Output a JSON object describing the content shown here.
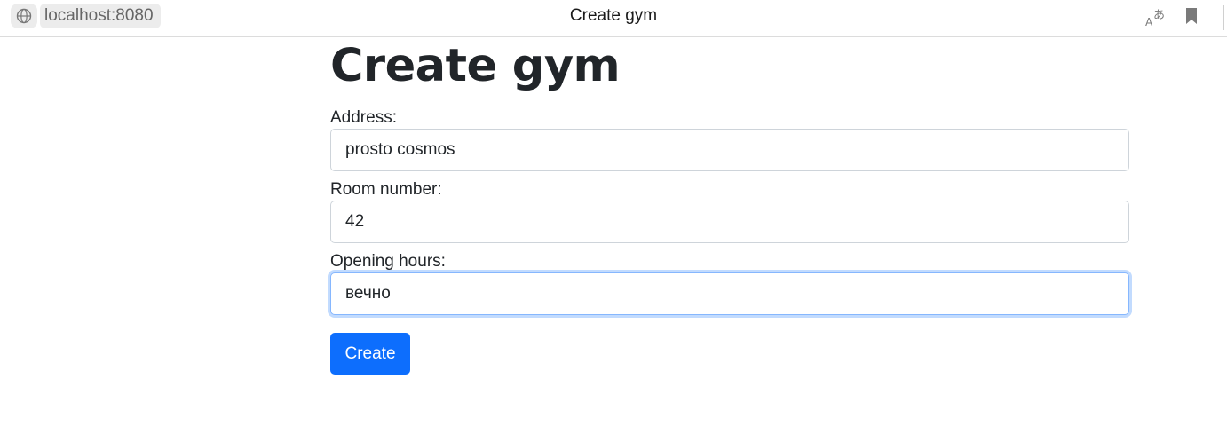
{
  "browser": {
    "url": "localhost:8080",
    "tab_title": "Create gym"
  },
  "page": {
    "heading": "Create gym",
    "fields": [
      {
        "label": "Address:",
        "value": "prosto cosmos"
      },
      {
        "label": "Room number:",
        "value": "42"
      },
      {
        "label": "Opening hours:",
        "value": "вечно"
      }
    ],
    "submit_label": "Create"
  },
  "colors": {
    "primary": "#0d6efd",
    "focus_border": "#86b7fe",
    "text": "#212529"
  },
  "icons": [
    "site-info-icon",
    "translate-icon",
    "bookmark-icon"
  ]
}
